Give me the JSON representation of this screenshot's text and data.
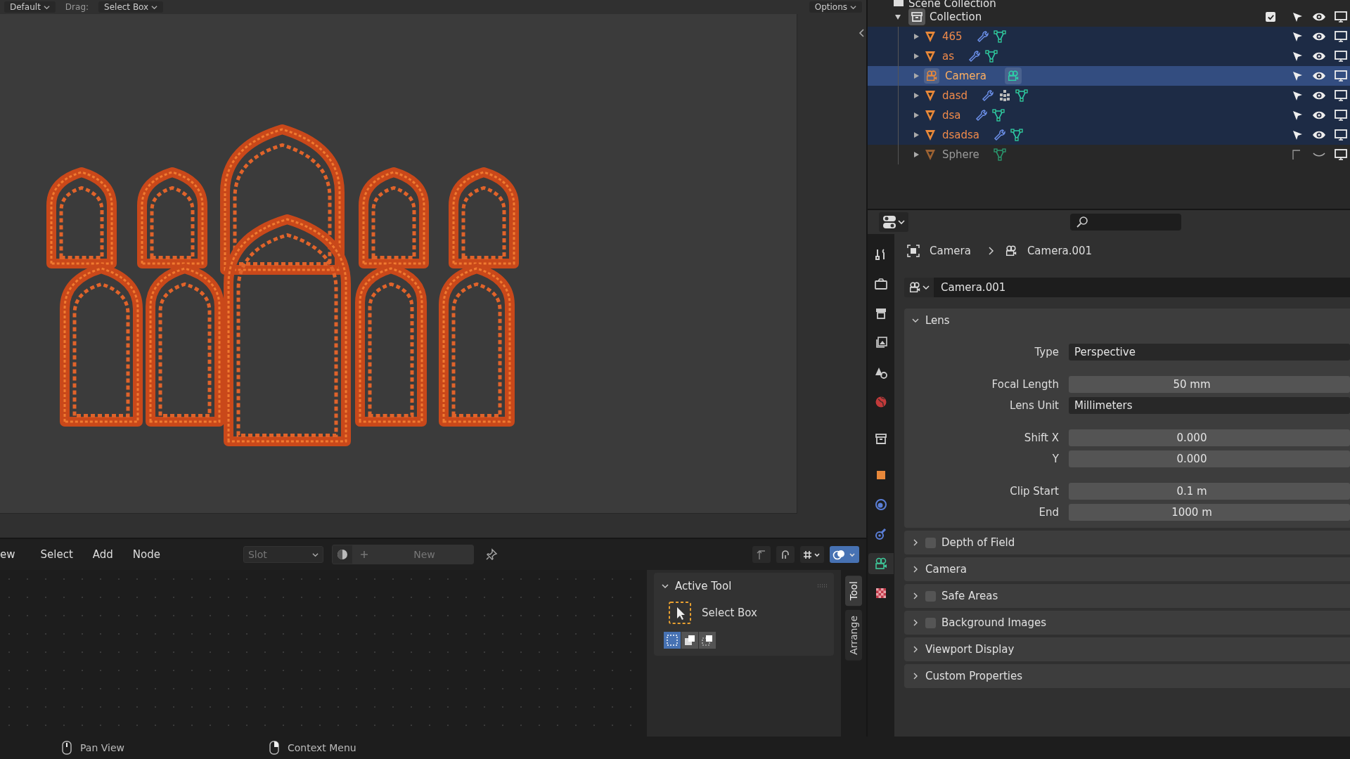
{
  "viewport": {
    "header": {
      "mode": "Default",
      "drag_label": "Drag:",
      "drag_tool": "Select Box",
      "options": "Options"
    }
  },
  "node_editor": {
    "menus": [
      "ew",
      "Select",
      "Add",
      "Node"
    ],
    "slot": "Slot",
    "new_button": "New",
    "tool_panel": {
      "title": "Active Tool",
      "expanded": true,
      "tool": "Select Box",
      "modes": [
        {
          "selected": true
        },
        {
          "selected": false
        },
        {
          "selected": false
        }
      ]
    },
    "side_tabs": [
      {
        "label": "Tool",
        "selected": true
      },
      {
        "label": "Arrange",
        "selected": false
      }
    ]
  },
  "outliner": {
    "root": "Scene Collection",
    "items": [
      {
        "label": "Collection",
        "expanded": true,
        "checked": true,
        "children": [
          {
            "label": "465",
            "kind": "mesh",
            "expanded": false,
            "selected": true,
            "active": false,
            "visible": true,
            "modifier": true,
            "particles": false
          },
          {
            "label": "as",
            "kind": "mesh",
            "expanded": false,
            "selected": true,
            "active": false,
            "visible": true,
            "modifier": true,
            "particles": false
          },
          {
            "label": "Camera",
            "kind": "camera",
            "expanded": false,
            "selected": true,
            "active": true,
            "visible": true,
            "modifier": false,
            "particles": false
          },
          {
            "label": "dasd",
            "kind": "mesh",
            "expanded": false,
            "selected": true,
            "active": false,
            "visible": true,
            "modifier": true,
            "particles": true
          },
          {
            "label": "dsa",
            "kind": "mesh",
            "expanded": false,
            "selected": true,
            "active": false,
            "visible": true,
            "modifier": true,
            "particles": false
          },
          {
            "label": "dsadsa",
            "kind": "mesh",
            "expanded": false,
            "selected": true,
            "active": false,
            "visible": true,
            "modifier": true,
            "particles": false
          },
          {
            "label": "Sphere",
            "kind": "mesh",
            "expanded": false,
            "selected": false,
            "active": false,
            "visible": false,
            "modifier": false,
            "particles": false
          }
        ]
      }
    ]
  },
  "properties": {
    "breadcrumb": [
      "Camera",
      "Camera.001"
    ],
    "datablock": "Camera.001",
    "tabs": [
      {
        "kind": "tool",
        "selected": false
      },
      {
        "kind": "render",
        "selected": false
      },
      {
        "kind": "output",
        "selected": false
      },
      {
        "kind": "view_layer",
        "selected": false
      },
      {
        "kind": "scene",
        "selected": false
      },
      {
        "kind": "world",
        "selected": false
      },
      {
        "kind": "collection",
        "selected": false
      },
      {
        "kind": "object",
        "selected": false
      },
      {
        "kind": "physics",
        "selected": false
      },
      {
        "kind": "constraints",
        "selected": false
      },
      {
        "kind": "data",
        "selected": true
      },
      {
        "kind": "texture",
        "selected": false
      }
    ],
    "panels": [
      {
        "title": "Lens",
        "expanded": true,
        "groups": [
          [
            {
              "label": "Type",
              "value": "Perspective",
              "kind": "dropdown"
            }
          ],
          [
            {
              "label": "Focal Length",
              "value": "50 mm",
              "kind": "number"
            },
            {
              "label": "Lens Unit",
              "value": "Millimeters",
              "kind": "dropdown"
            }
          ],
          [
            {
              "label": "Shift X",
              "value": "0.000",
              "kind": "number"
            },
            {
              "label": "Y",
              "value": "0.000",
              "kind": "number"
            }
          ],
          [
            {
              "label": "Clip Start",
              "value": "0.1 m",
              "kind": "number"
            },
            {
              "label": "End",
              "value": "1000 m",
              "kind": "number"
            }
          ]
        ]
      },
      {
        "title": "Depth of Field",
        "expanded": false,
        "has_checkbox": true,
        "checked": false
      },
      {
        "title": "Camera",
        "expanded": false
      },
      {
        "title": "Safe Areas",
        "expanded": false,
        "has_checkbox": true,
        "checked": false
      },
      {
        "title": "Background Images",
        "expanded": false,
        "has_checkbox": true,
        "checked": false
      },
      {
        "title": "Viewport Display",
        "expanded": false
      },
      {
        "title": "Custom Properties",
        "expanded": false
      }
    ]
  },
  "status_bar": [
    {
      "kind": "middle",
      "label": "Pan View"
    },
    {
      "kind": "right",
      "label": "Context Menu"
    }
  ]
}
